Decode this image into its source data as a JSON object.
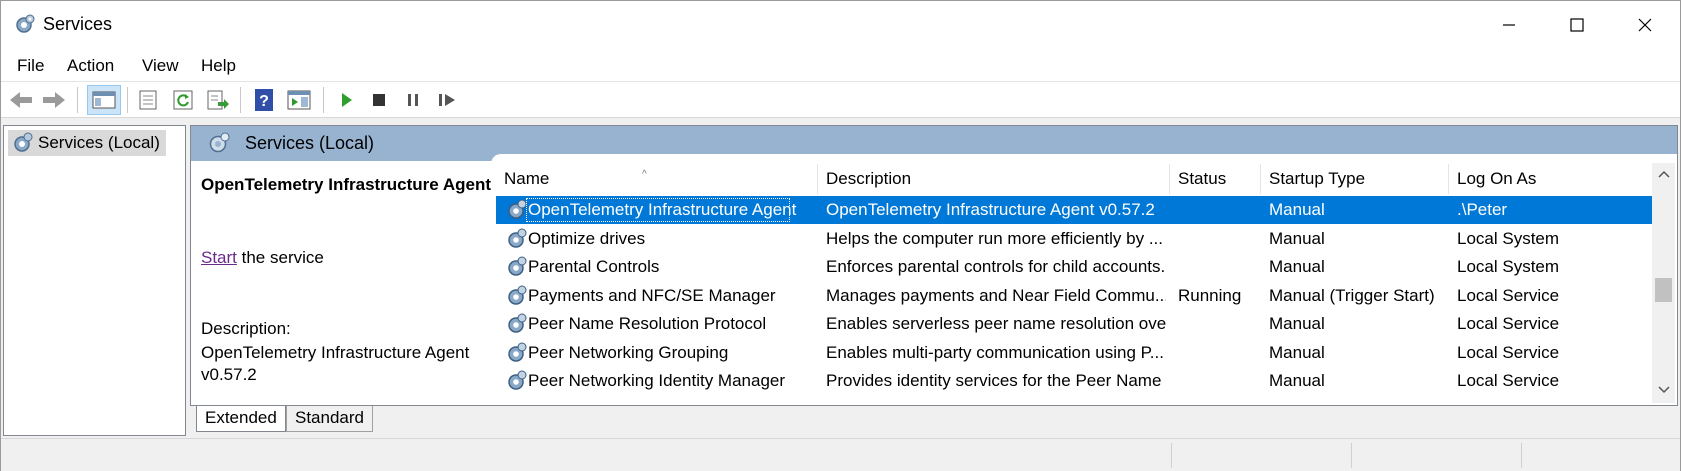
{
  "window": {
    "title": "Services",
    "minimize_icon": "minimize-icon",
    "maximize_icon": "maximize-icon",
    "close_icon": "close-icon"
  },
  "menu": [
    "File",
    "Action",
    "View",
    "Help"
  ],
  "toolbar": {
    "icons": [
      "back-arrow-icon",
      "forward-arrow-icon",
      "show-hide-console-tree-icon",
      "properties-icon",
      "refresh-icon",
      "export-list-icon",
      "help-icon",
      "show-action-pane-icon",
      "start-service-icon",
      "stop-service-icon",
      "pause-service-icon",
      "restart-service-icon"
    ]
  },
  "tree": {
    "root_label": "Services (Local)"
  },
  "panel": {
    "header_title": "Services (Local)",
    "selected_name": "OpenTelemetry Infrastructure Agent",
    "action_link": "Start",
    "action_suffix": " the service",
    "description_label": "Description:",
    "description_text": "OpenTelemetry Infrastructure Agent v0.57.2"
  },
  "columns": [
    "Name",
    "Description",
    "Status",
    "Startup Type",
    "Log On As"
  ],
  "rows": [
    {
      "name": "OpenTelemetry Infrastructure Agent",
      "description": "OpenTelemetry Infrastructure Agent v0.57.2",
      "status": "",
      "startup": "Manual",
      "logon": ".\\Peter",
      "selected": true
    },
    {
      "name": "Optimize drives",
      "description": "Helps the computer run more efficiently by ...",
      "status": "",
      "startup": "Manual",
      "logon": "Local System",
      "selected": false
    },
    {
      "name": "Parental Controls",
      "description": "Enforces parental controls for child accounts...",
      "status": "",
      "startup": "Manual",
      "logon": "Local System",
      "selected": false
    },
    {
      "name": "Payments and NFC/SE Manager",
      "description": "Manages payments and Near Field Commu...",
      "status": "Running",
      "startup": "Manual (Trigger Start)",
      "logon": "Local Service",
      "selected": false
    },
    {
      "name": "Peer Name Resolution Protocol",
      "description": "Enables serverless peer name resolution ove...",
      "status": "",
      "startup": "Manual",
      "logon": "Local Service",
      "selected": false
    },
    {
      "name": "Peer Networking Grouping",
      "description": "Enables multi-party communication using P...",
      "status": "",
      "startup": "Manual",
      "logon": "Local Service",
      "selected": false
    },
    {
      "name": "Peer Networking Identity Manager",
      "description": "Provides identity services for the Peer Name ...",
      "status": "",
      "startup": "Manual",
      "logon": "Local Service",
      "selected": false
    }
  ],
  "tabs": [
    {
      "label": "Extended",
      "active": true
    },
    {
      "label": "Standard",
      "active": false
    }
  ],
  "colors": {
    "selection": "#0078d7",
    "panel_header": "#98b3d0",
    "link": "#6b2b8a"
  }
}
